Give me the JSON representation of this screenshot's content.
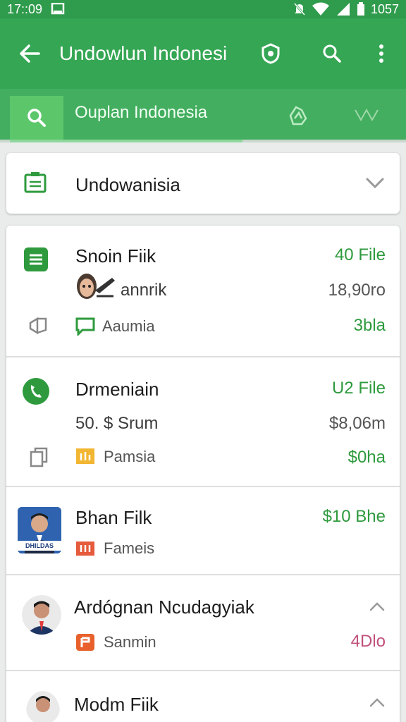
{
  "status_bar": {
    "time": "17::09",
    "battery_text": "1057"
  },
  "app_bar": {
    "title": "Undowlun Indonesi"
  },
  "search": {
    "query": "Ouplan Indonesia"
  },
  "dropdown": {
    "label": "Undowanisia"
  },
  "items": [
    {
      "title": "Snoin Fiik",
      "meta_right": "40 File",
      "line2": "annrik",
      "line2_right": "18,90ro",
      "line3": "Aaumia",
      "line3_right": "3bla"
    },
    {
      "title": "Drmeniain",
      "meta_right": "U2 File",
      "line2": "50. $ Srum",
      "line2_right": "$8,06m",
      "line3": "Pamsia",
      "line3_right": "$0ha"
    },
    {
      "title": "Bhan Filk",
      "meta_right": "$10 Bhe",
      "line3": "Fameis",
      "avatar_caption": "DHILDAS"
    },
    {
      "title": "Ardógnan Ncudagyiak",
      "line3": "Sanmin",
      "line3_right": "4Dlo"
    },
    {
      "title": "Modm Fiik"
    }
  ],
  "colors": {
    "primary": "#35a654",
    "status": "#2f9b4c",
    "accent_green": "#2e9a3d",
    "pink": "#c0507a"
  }
}
